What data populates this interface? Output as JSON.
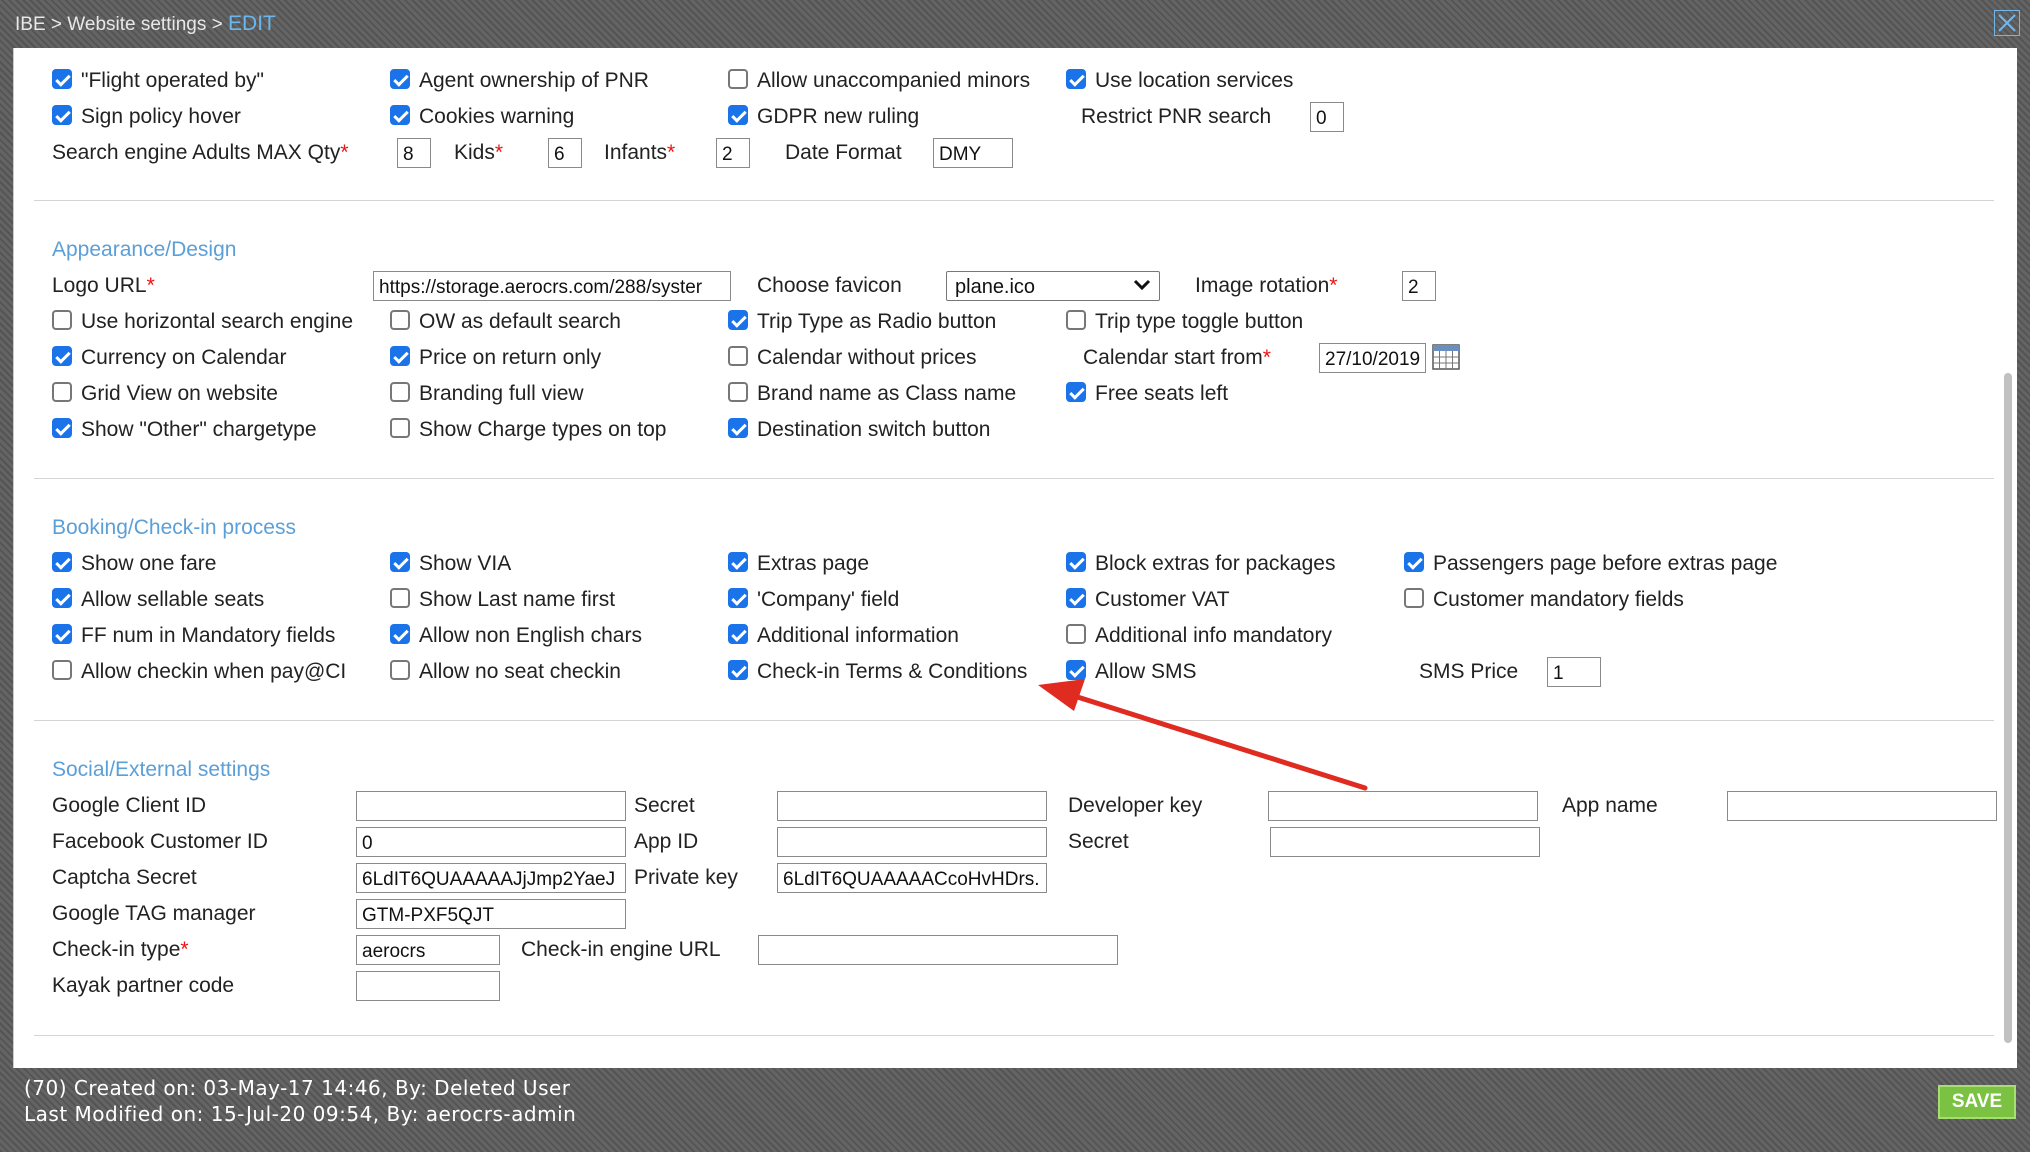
{
  "breadcrumb": {
    "p1": "IBE",
    "sep": ">",
    "p2": "Website settings",
    "p3": "EDIT"
  },
  "general": {
    "flight_operated_by": {
      "label": "\"Flight operated by\"",
      "checked": true
    },
    "agent_ownership": {
      "label": "Agent ownership of PNR",
      "checked": true
    },
    "allow_unaccompanied": {
      "label": "Allow unaccompanied minors",
      "checked": false
    },
    "use_location": {
      "label": "Use location services",
      "checked": true
    },
    "sign_policy_hover": {
      "label": "Sign policy hover",
      "checked": true
    },
    "cookies_warning": {
      "label": "Cookies warning",
      "checked": true
    },
    "gdpr": {
      "label": "GDPR new ruling",
      "checked": true
    },
    "restrict_pnr_label": "Restrict PNR search",
    "restrict_pnr_value": "0",
    "adults_label": "Search engine Adults MAX Qty",
    "adults_value": "8",
    "kids_label": "Kids",
    "kids_value": "6",
    "infants_label": "Infants",
    "infants_value": "2",
    "date_format_label": "Date Format",
    "date_format_value": "DMY",
    "required_mark": "*"
  },
  "appearance": {
    "title": "Appearance/Design",
    "logo_url_label": "Logo URL",
    "logo_url_value": "https://storage.aerocrs.com/288/syster",
    "favicon_label": "Choose favicon",
    "favicon_value": "plane.ico",
    "image_rotation_label": "Image rotation",
    "image_rotation_value": "2",
    "horizontal_search": {
      "label": "Use horizontal search engine",
      "checked": false
    },
    "ow_default": {
      "label": "OW as default search",
      "checked": false
    },
    "trip_type_radio": {
      "label": "Trip Type as Radio button",
      "checked": true
    },
    "trip_type_toggle": {
      "label": "Trip type toggle button",
      "checked": false
    },
    "currency_calendar": {
      "label": "Currency on Calendar",
      "checked": true
    },
    "price_return": {
      "label": "Price on return only",
      "checked": true
    },
    "calendar_no_prices": {
      "label": "Calendar without prices",
      "checked": false
    },
    "calendar_start_label": "Calendar start from",
    "calendar_start_value": "27/10/2019",
    "grid_view": {
      "label": "Grid View on website",
      "checked": false
    },
    "branding_full": {
      "label": "Branding full view",
      "checked": false
    },
    "brand_as_class": {
      "label": "Brand name as Class name",
      "checked": false
    },
    "free_seats": {
      "label": "Free seats left",
      "checked": true
    },
    "show_other": {
      "label": "Show \"Other\" chargetype",
      "checked": true
    },
    "charge_types_top": {
      "label": "Show Charge types on top",
      "checked": false
    },
    "destination_switch": {
      "label": "Destination switch button",
      "checked": true
    }
  },
  "booking": {
    "title": "Booking/Check-in process",
    "show_one_fare": {
      "label": "Show one fare",
      "checked": true
    },
    "show_via": {
      "label": "Show VIA",
      "checked": true
    },
    "extras_page": {
      "label": "Extras page",
      "checked": true
    },
    "block_extras": {
      "label": "Block extras for packages",
      "checked": true
    },
    "passengers_before_extras": {
      "label": "Passengers page before extras page",
      "checked": true
    },
    "sellable_seats": {
      "label": "Allow sellable seats",
      "checked": true
    },
    "last_name_first": {
      "label": "Show Last name first",
      "checked": false
    },
    "company_field": {
      "label": "'Company' field",
      "checked": true
    },
    "customer_vat": {
      "label": "Customer VAT",
      "checked": true
    },
    "customer_mandatory": {
      "label": "Customer mandatory fields",
      "checked": false
    },
    "ff_num": {
      "label": "FF num in Mandatory fields",
      "checked": true
    },
    "non_english": {
      "label": "Allow non English chars",
      "checked": true
    },
    "additional_info": {
      "label": "Additional information",
      "checked": true
    },
    "additional_info_mandatory": {
      "label": "Additional info mandatory",
      "checked": false
    },
    "checkin_pay": {
      "label": "Allow checkin when pay@CI",
      "checked": false
    },
    "no_seat_checkin": {
      "label": "Allow no seat checkin",
      "checked": false
    },
    "checkin_terms": {
      "label": "Check-in Terms & Conditions",
      "checked": true
    },
    "allow_sms": {
      "label": "Allow SMS",
      "checked": true
    },
    "sms_price_label": "SMS Price",
    "sms_price_value": "1"
  },
  "social": {
    "title": "Social/External settings",
    "google_client_label": "Google Client ID",
    "google_client_value": "",
    "secret_label": "Secret",
    "secret_value": "",
    "developer_key_label": "Developer key",
    "developer_key_value": "",
    "app_name_label": "App name",
    "app_name_value": "",
    "facebook_label": "Facebook Customer ID",
    "facebook_value": "0",
    "app_id_label": "App ID",
    "app_id_value": "",
    "secret2_label": "Secret",
    "secret2_value": "",
    "captcha_label": "Captcha Secret",
    "captcha_value": "6LdIT6QUAAAAAJjJmp2YaeJ",
    "private_key_label": "Private key",
    "private_key_value": "6LdIT6QUAAAAACcoHvHDrs.",
    "gtm_label": "Google TAG manager",
    "gtm_value": "GTM-PXF5QJT",
    "checkin_type_label": "Check-in type",
    "checkin_type_value": "aerocrs",
    "checkin_url_label": "Check-in engine URL",
    "checkin_url_value": "",
    "kayak_label": "Kayak partner code",
    "kayak_value": ""
  },
  "footer": {
    "created": "(70) Created on: 03-May-17 14:46, By: Deleted User",
    "modified": "Last Modified on: 15-Jul-20 09:54, By: aerocrs-admin"
  },
  "save_label": "SAVE",
  "colors": {
    "accent": "#5b9fd8",
    "checkbox": "#1a73e8",
    "save": "#7bc242",
    "arrow": "#e02b20",
    "required": "#e11111"
  },
  "icons": {
    "close": "close-icon",
    "calendar": "calendar-icon",
    "chevron": "chevron-down-icon"
  }
}
